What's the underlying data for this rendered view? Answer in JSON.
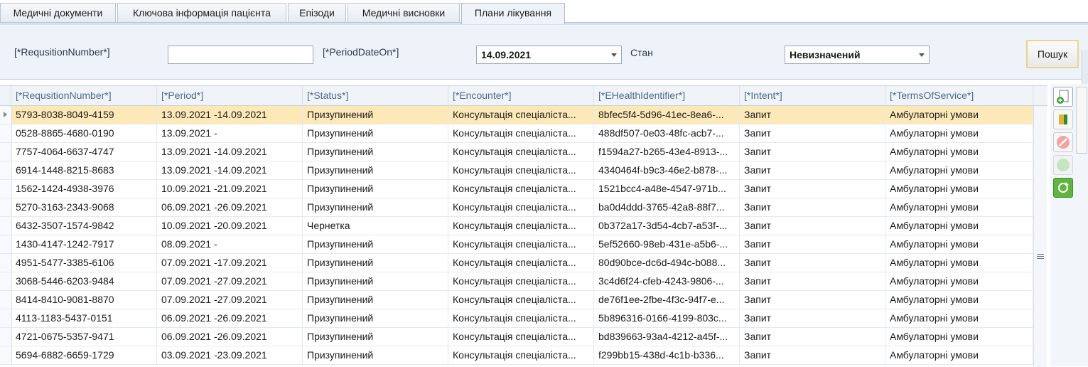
{
  "tabs": [
    {
      "label": "Медичні документи"
    },
    {
      "label": "Ключова інформація пацієнта"
    },
    {
      "label": "Епізоди"
    },
    {
      "label": "Медичні висновки"
    },
    {
      "label": "Плани лікування"
    }
  ],
  "filter": {
    "requisition_label": "[*RequsitionNumber*]",
    "requisition_value": "",
    "period_label": "[*PeriodDateOn*]",
    "period_value": "14.09.2021",
    "status_label": "Стан",
    "status_value": "Невизначений",
    "search_button": "Пошук"
  },
  "grid": {
    "columns": [
      "[*RequsitionNumber*]",
      "[*Period*]",
      "[*Status*]",
      "[*Encounter*]",
      "[*EHealthIdentifier*]",
      "[*Intent*]",
      "[*TermsOfService*]"
    ],
    "rows": [
      [
        "5793-8038-8049-4159",
        "13.09.2021 -14.09.2021",
        "Призупинений",
        "Консультація спеціаліста...",
        "8bfec5f4-5d96-41ec-8ea6-...",
        "Запит",
        "Амбулаторні умови"
      ],
      [
        "0528-8865-4680-0190",
        "13.09.2021 -",
        "Призупинений",
        "Консультація спеціаліста...",
        "488df507-0e03-48fc-acb7-...",
        "Запит",
        "Амбулаторні умови"
      ],
      [
        "7757-4064-6637-4747",
        "13.09.2021 -14.09.2021",
        "Призупинений",
        "Консультація спеціаліста...",
        "f1594a27-b265-43e4-8913-...",
        "Запит",
        "Амбулаторні умови"
      ],
      [
        "6914-1448-8215-8683",
        "13.09.2021 -14.09.2021",
        "Призупинений",
        "Консультація спеціаліста...",
        "4340464f-b9c3-46e2-b878-...",
        "Запит",
        "Амбулаторні умови"
      ],
      [
        "1562-1424-4938-3976",
        "10.09.2021 -21.09.2021",
        "Призупинений",
        "Консультація спеціаліста...",
        "1521bcc4-a48e-4547-971b...",
        "Запит",
        "Амбулаторні умови"
      ],
      [
        "5270-3163-2343-9068",
        "06.09.2021 -26.09.2021",
        "Призупинений",
        "Консультація спеціаліста...",
        "ba0d4ddd-3765-42a8-88f7...",
        "Запит",
        "Амбулаторні умови"
      ],
      [
        "6432-3507-1574-9842",
        "10.09.2021 -20.09.2021",
        "Чернетка",
        "Консультація спеціаліста...",
        "0b372a17-3d54-4cb7-a53f-...",
        "Запит",
        "Амбулаторні умови"
      ],
      [
        "1430-4147-1242-7917",
        "08.09.2021 -",
        "Призупинений",
        "Консультація спеціаліста...",
        "5ef52660-98eb-431e-a5b6-...",
        "Запит",
        "Амбулаторні умови"
      ],
      [
        "4951-5477-3385-6106",
        "07.09.2021 -17.09.2021",
        "Призупинений",
        "Консультація спеціаліста...",
        "80d90bce-dc6d-494c-b088...",
        "Запит",
        "Амбулаторні умови"
      ],
      [
        "3068-5446-6203-9484",
        "07.09.2021 -27.09.2021",
        "Призупинений",
        "Консультація спеціаліста...",
        "3c4d6f24-cfeb-4243-9806-...",
        "Запит",
        "Амбулаторні умови"
      ],
      [
        "8414-8410-9081-8870",
        "07.09.2021 -27.09.2021",
        "Призупинений",
        "Консультація спеціаліста...",
        "de76f1ee-2fbe-4f3c-94f7-e...",
        "Запит",
        "Амбулаторні умови"
      ],
      [
        "4113-1183-5437-0151",
        "06.09.2021 -26.09.2021",
        "Призупинений",
        "Консультація спеціаліста...",
        "5b896316-0166-4199-803c...",
        "Запит",
        "Амбулаторні умови"
      ],
      [
        "4721-0675-5357-9471",
        "06.09.2021 -26.09.2021",
        "Призупинений",
        "Консультація спеціаліста...",
        "bd839663-93a4-4212-a45f-...",
        "Запит",
        "Амбулаторні умови"
      ],
      [
        "5694-6882-6659-1729",
        "03.09.2021 -23.09.2021",
        "Призупинений",
        "Консультація спеціаліста...",
        "f299bb15-438d-4c1b-b336...",
        "Запит",
        "Амбулаторні умови"
      ]
    ]
  },
  "toolbar_icons": [
    "add-document-icon",
    "edit-icon",
    "cancel-icon",
    "complete-icon",
    "refresh-icon"
  ]
}
